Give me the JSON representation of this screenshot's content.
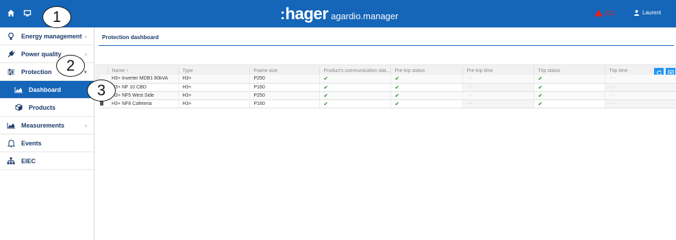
{
  "topbar": {
    "brand_colon": ":",
    "brand_name": "hager",
    "brand_product": "agardio.manager",
    "alert_count": "211",
    "user_name": "Laurent",
    "colors": {
      "bar": "#1565b8",
      "alert": "#e02020"
    }
  },
  "sidebar": {
    "items": [
      {
        "label": "Energy management",
        "icon": "lightbulb-icon",
        "chevron": "›"
      },
      {
        "label": "Power quality",
        "icon": "plug-icon",
        "chevron": "›"
      },
      {
        "label": "Protection",
        "icon": "sliders-icon",
        "chevron": "▾"
      },
      {
        "label": "Dashboard",
        "icon": "area-chart-icon",
        "active": true
      },
      {
        "label": "Products",
        "icon": "cube-icon"
      },
      {
        "label": "Measurements",
        "icon": "area-chart-icon",
        "chevron": "›"
      },
      {
        "label": "Events",
        "icon": "bell-icon"
      },
      {
        "label": "EIEC",
        "icon": "sitemap-icon"
      }
    ]
  },
  "main": {
    "title": "Protection dashboard",
    "toolbar": {
      "refresh_icon": "refresh-icon",
      "export_icon": "export-icon"
    },
    "table": {
      "columns": [
        "",
        "Name ↑",
        "Type",
        "Frame size",
        "Product's communication stat...",
        "Pre-trip status",
        "Pre-trip time",
        "Trip status",
        "Trip time"
      ],
      "rows": [
        {
          "icon": false,
          "name": "H3+ Inverter MDB1 80kVA",
          "type": "H3+",
          "frame": "P250",
          "comm": "✔",
          "pretrip": "✔",
          "pretrip_time": "----",
          "trip": "✔",
          "trip_time": "----"
        },
        {
          "icon": false,
          "name": "H3+ NF 10 CBD",
          "type": "H3+",
          "frame": "P160",
          "comm": "✔",
          "pretrip": "✔",
          "pretrip_time": "----",
          "trip": "✔",
          "trip_time": "----"
        },
        {
          "icon": false,
          "name": "H3+ NF5 West Side",
          "type": "H3+",
          "frame": "P250",
          "comm": "✔",
          "pretrip": "✔",
          "pretrip_time": "----",
          "trip": "✔",
          "trip_time": "----"
        },
        {
          "icon": true,
          "name": "H3+ NF8 Cafeteria",
          "type": "H3+",
          "frame": "P160",
          "comm": "✔",
          "pretrip": "✔",
          "pretrip_time": "----",
          "trip": "✔",
          "trip_time": "----"
        }
      ]
    }
  },
  "callouts": [
    "1",
    "2",
    "3"
  ]
}
